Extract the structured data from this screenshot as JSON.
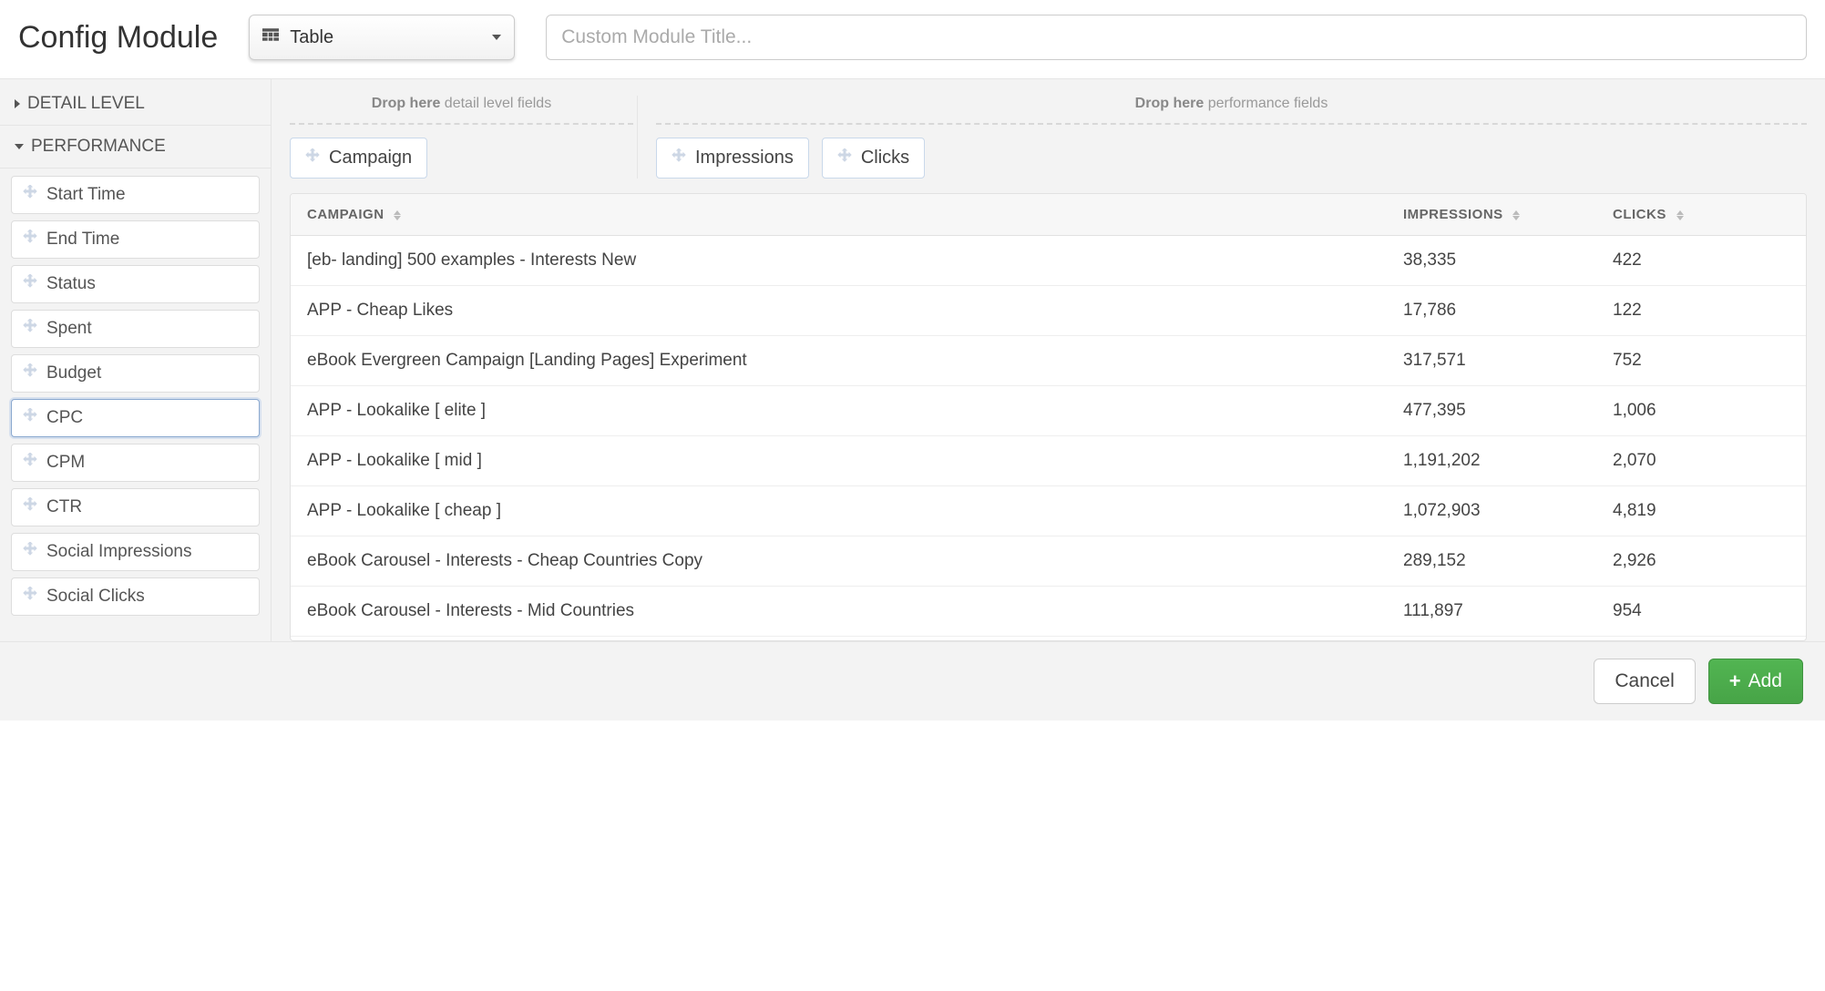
{
  "header": {
    "title": "Config Module",
    "type_select_label": "Table",
    "title_input_placeholder": "Custom Module Title..."
  },
  "sidebar": {
    "sections": [
      {
        "label": "DETAIL LEVEL",
        "expanded": false
      },
      {
        "label": "PERFORMANCE",
        "expanded": true
      }
    ],
    "performance_fields": [
      {
        "label": "Start Time",
        "selected": false
      },
      {
        "label": "End Time",
        "selected": false
      },
      {
        "label": "Status",
        "selected": false
      },
      {
        "label": "Spent",
        "selected": false
      },
      {
        "label": "Budget",
        "selected": false
      },
      {
        "label": "CPC",
        "selected": true
      },
      {
        "label": "CPM",
        "selected": false
      },
      {
        "label": "CTR",
        "selected": false
      },
      {
        "label": "Social Impressions",
        "selected": false
      },
      {
        "label": "Social Clicks",
        "selected": false
      }
    ]
  },
  "dropzones": {
    "detail_label_bold": "Drop here",
    "detail_label_rest": " detail level fields",
    "perf_label_bold": "Drop here",
    "perf_label_rest": " performance fields",
    "detail_chips": [
      {
        "label": "Campaign"
      }
    ],
    "perf_chips": [
      {
        "label": "Impressions"
      },
      {
        "label": "Clicks"
      }
    ]
  },
  "table": {
    "columns": [
      {
        "label": "CAMPAIGN"
      },
      {
        "label": "IMPRESSIONS"
      },
      {
        "label": "CLICKS"
      }
    ],
    "rows": [
      {
        "campaign": "[eb- landing] 500 examples - Interests New",
        "impressions": "38,335",
        "clicks": "422"
      },
      {
        "campaign": "APP - Cheap Likes",
        "impressions": "17,786",
        "clicks": "122"
      },
      {
        "campaign": "eBook Evergreen Campaign [Landing Pages] Experiment",
        "impressions": "317,571",
        "clicks": "752"
      },
      {
        "campaign": "APP - Lookalike [ elite ]",
        "impressions": "477,395",
        "clicks": "1,006"
      },
      {
        "campaign": "APP - Lookalike [ mid ]",
        "impressions": "1,191,202",
        "clicks": "2,070"
      },
      {
        "campaign": "APP - Lookalike [ cheap ]",
        "impressions": "1,072,903",
        "clicks": "4,819"
      },
      {
        "campaign": "eBook Carousel - Interests - Cheap Countries Copy",
        "impressions": "289,152",
        "clicks": "2,926"
      },
      {
        "campaign": "eBook Carousel - Interests - Mid Countries",
        "impressions": "111,897",
        "clicks": "954"
      }
    ]
  },
  "footer": {
    "cancel_label": "Cancel",
    "add_label": "Add"
  }
}
